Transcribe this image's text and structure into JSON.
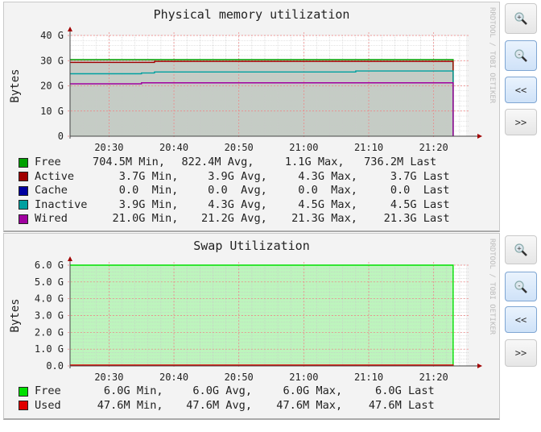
{
  "charts": [
    {
      "title": "Physical memory utilization",
      "ylabel": "Bytes",
      "watermark": "RRDTOOL / TOBI OETIKER",
      "legend": [
        {
          "name": "Free",
          "color": "#00a000",
          "min": "704.5M",
          "avg": "822.4M",
          "max": "1.1G",
          "last": "736.2M"
        },
        {
          "name": "Active",
          "color": "#a00000",
          "min": "3.7G",
          "avg": "3.9G",
          "max": "4.3G",
          "last": "3.7G"
        },
        {
          "name": "Cache",
          "color": "#0000a0",
          "min": "0.0",
          "avg": "0.0",
          "max": "0.0",
          "last": "0.0"
        },
        {
          "name": "Inactive",
          "color": "#00a0a0",
          "min": "3.9G",
          "avg": "4.3G",
          "max": "4.5G",
          "last": "4.5G"
        },
        {
          "name": "Wired",
          "color": "#a000a0",
          "min": "21.0G",
          "avg": "21.2G",
          "max": "21.3G",
          "last": "21.3G"
        }
      ],
      "labels": {
        "min": "Min,",
        "avg": "Avg,",
        "max": "Max,",
        "last": "Last"
      },
      "buttons": {
        "zoom_in": "+",
        "zoom_out": "-",
        "back": "<<",
        "forward": ">>"
      }
    },
    {
      "title": "Swap Utilization",
      "ylabel": "Bytes",
      "watermark": "RRDTOOL / TOBI OETIKER",
      "legend": [
        {
          "name": "Free",
          "color": "#00e000",
          "min": "6.0G",
          "avg": "6.0G",
          "max": "6.0G",
          "last": "6.0G"
        },
        {
          "name": "Used",
          "color": "#e00000",
          "min": "47.6M",
          "avg": "47.6M",
          "max": "47.6M",
          "last": "47.6M"
        }
      ],
      "labels": {
        "min": "Min,",
        "avg": "Avg,",
        "max": "Max,",
        "last": "Last"
      },
      "buttons": {
        "zoom_in": "+",
        "zoom_out": "-",
        "back": "<<",
        "forward": ">>"
      }
    }
  ],
  "chart_data": [
    {
      "type": "line",
      "title": "Physical memory utilization",
      "xlabel": "",
      "ylabel": "Bytes",
      "x_range": [
        "20:24",
        "21:25"
      ],
      "x_ticks": [
        "20:30",
        "20:40",
        "20:50",
        "21:00",
        "21:10",
        "21:20"
      ],
      "y_ticks": [
        {
          "v": 0,
          "label": "0"
        },
        {
          "v": 10,
          "label": "10 G"
        },
        {
          "v": 20,
          "label": "20 G"
        },
        {
          "v": 30,
          "label": "30 G"
        },
        {
          "v": 40,
          "label": "40 G"
        }
      ],
      "ylim": [
        0,
        40
      ],
      "y_unit": "G",
      "grid": true,
      "fill": {
        "series": "Free",
        "color": "#c5ccc5"
      },
      "series": [
        {
          "name": "Free",
          "color": "#00a000",
          "points": [
            [
              "20:24",
              30.4
            ],
            [
              "21:23",
              30.4
            ]
          ]
        },
        {
          "name": "Active",
          "color": "#a00000",
          "points": [
            [
              "20:24",
              29.3
            ],
            [
              "20:37",
              29.7
            ],
            [
              "21:23",
              29.7
            ]
          ]
        },
        {
          "name": "Inactive",
          "color": "#00a0a0",
          "points": [
            [
              "20:24",
              24.8
            ],
            [
              "20:35",
              25.1
            ],
            [
              "20:37",
              25.5
            ],
            [
              "21:08",
              25.9
            ],
            [
              "21:23",
              25.9
            ]
          ]
        },
        {
          "name": "Wired",
          "color": "#a000a0",
          "points": [
            [
              "20:24",
              20.8
            ],
            [
              "20:35",
              21.2
            ],
            [
              "21:23",
              21.2
            ]
          ]
        }
      ]
    },
    {
      "type": "area",
      "title": "Swap Utilization",
      "xlabel": "",
      "ylabel": "Bytes",
      "x_range": [
        "20:24",
        "21:25"
      ],
      "x_ticks": [
        "20:30",
        "20:40",
        "20:50",
        "21:00",
        "21:10",
        "21:20"
      ],
      "y_ticks": [
        {
          "v": 0,
          "label": "0.0"
        },
        {
          "v": 1,
          "label": "1.0 G"
        },
        {
          "v": 2,
          "label": "2.0 G"
        },
        {
          "v": 3,
          "label": "3.0 G"
        },
        {
          "v": 4,
          "label": "4.0 G"
        },
        {
          "v": 5,
          "label": "5.0 G"
        },
        {
          "v": 6,
          "label": "6.0 G"
        }
      ],
      "ylim": [
        0,
        6
      ],
      "y_unit": "G",
      "grid": true,
      "fill": {
        "series": "Free",
        "color": "#bdf5bd"
      },
      "series": [
        {
          "name": "Free",
          "color": "#00e000",
          "points": [
            [
              "20:24",
              6.0
            ],
            [
              "21:23",
              6.0
            ]
          ]
        },
        {
          "name": "Used",
          "color": "#e00000",
          "points": [
            [
              "20:24",
              0.0476
            ],
            [
              "21:23",
              0.0476
            ]
          ]
        }
      ]
    }
  ]
}
